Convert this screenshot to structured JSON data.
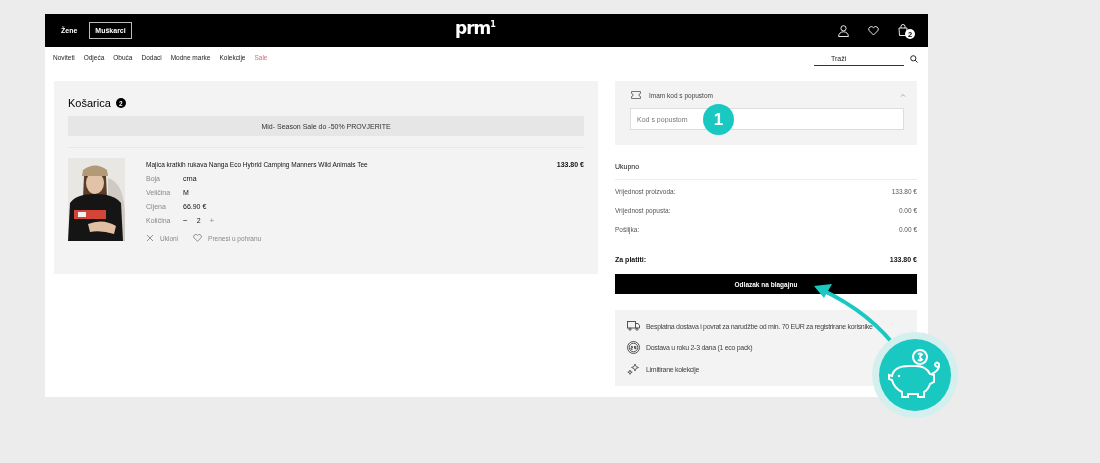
{
  "header": {
    "gender_tabs": [
      {
        "label": "Žene",
        "selected": false
      },
      {
        "label": "Muškarci",
        "selected": true
      }
    ],
    "logo": "prm$^{1}$",
    "cart_count": "2"
  },
  "nav": {
    "items": [
      {
        "label": "Noviteti",
        "sale": false
      },
      {
        "label": "Odjeća",
        "sale": false
      },
      {
        "label": "Obuća",
        "sale": false
      },
      {
        "label": "Dodaci",
        "sale": false
      },
      {
        "label": "Modne marke",
        "sale": false
      },
      {
        "label": "Kolekcije",
        "sale": false
      },
      {
        "label": "Sale",
        "sale": true
      }
    ],
    "search": {
      "placeholder": "Traži"
    }
  },
  "cart": {
    "title": "Košarica",
    "count": "2",
    "banner": "Mid- Season Sale do -50% PROVJERITE",
    "items": [
      {
        "name": "Majica kratkih rukava Nanga Eco Hybrid Camping Manners Wild Animals Tee",
        "price": "133.80 €",
        "image": {
          "kind": "picture"
        },
        "attributes": [
          {
            "label": "Boja",
            "value": "crna"
          },
          {
            "label": "Veličina",
            "value": "M"
          },
          {
            "label": "Cijena",
            "value": "66.90 €"
          }
        ],
        "quantity": {
          "label": "Količina",
          "minus": "−",
          "value": "2",
          "plus": "+",
          "plus_disabled": true
        },
        "actions": [
          {
            "kind": "remove",
            "label": "Ukloni"
          },
          {
            "kind": "wishlist",
            "label": "Prenesi u pohranu"
          }
        ]
      }
    ]
  },
  "discount": {
    "label": "Imam kod s popustom",
    "expanded": true,
    "placeholder": "Kod s popustom"
  },
  "summary": {
    "title": "Ukupno",
    "rows": [
      {
        "label": "Vrijednost proizvoda:",
        "value": "133.80 €"
      },
      {
        "label": "Vrijednost popusta:",
        "value": "0.00 €"
      },
      {
        "label": "Pošiljka:",
        "value": "0.00 €"
      }
    ],
    "total": {
      "label": "Za platiti:",
      "value": "133.80 €"
    },
    "checkout_button": "Odlazak na blagajnu"
  },
  "benefits": [
    {
      "kind": "truck",
      "text": "Besplatna dostava i povrat za narudžbe od min. 70 EUR za registrirane korisnike"
    },
    {
      "kind": "clock24",
      "text": "Dostava u roku 2-3 dana (1 eco pack)"
    },
    {
      "kind": "sparkle",
      "text": "Limitirane kolekcije"
    }
  ],
  "annotations": {
    "step": "1"
  }
}
